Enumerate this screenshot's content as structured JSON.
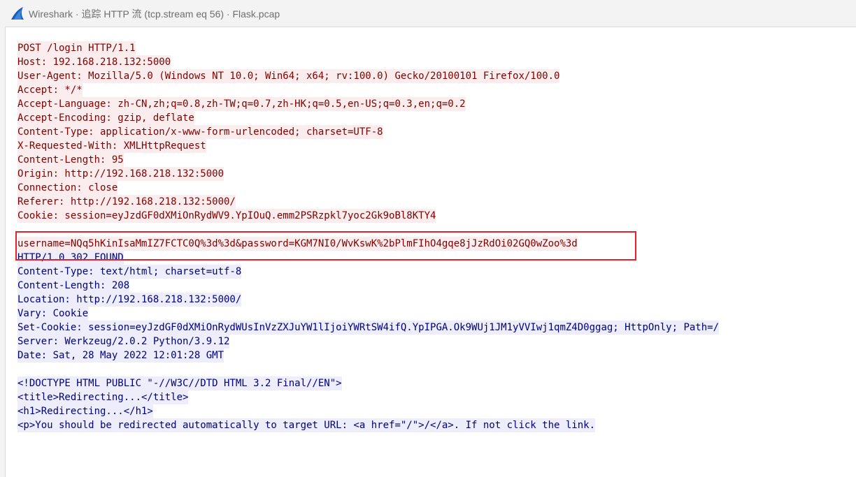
{
  "window": {
    "title": "Wireshark · 追踪 HTTP 流 (tcp.stream eq 56) · Flask.pcap",
    "icon": "wireshark-fin-icon"
  },
  "colors": {
    "client_text": "#7f0000",
    "client_bg": "#fbeded",
    "server_text": "#00007f",
    "server_bg": "#ededfb",
    "highlight_border": "#e3222b"
  },
  "request": {
    "lines": [
      "POST /login HTTP/1.1",
      "Host: 192.168.218.132:5000",
      "User-Agent: Mozilla/5.0 (Windows NT 10.0; Win64; x64; rv:100.0) Gecko/20100101 Firefox/100.0",
      "Accept: */*",
      "Accept-Language: zh-CN,zh;q=0.8,zh-TW;q=0.7,zh-HK;q=0.5,en-US;q=0.3,en;q=0.2",
      "Accept-Encoding: gzip, deflate",
      "Content-Type: application/x-www-form-urlencoded; charset=UTF-8",
      "X-Requested-With: XMLHttpRequest",
      "Content-Length: 95",
      "Origin: http://192.168.218.132:5000",
      "Connection: close",
      "Referer: http://192.168.218.132:5000/",
      "Cookie: session=eyJzdGF0dXMiOnRydWV9.YpIOuQ.emm2PSRzpkl7yoc2Gk9oBl8KTY4"
    ],
    "body": "username=NQq5hKinIsaMmIZ7FCTC0Q%3d%3d&password=KGM7NI0/WvKswK%2bPlmFIhO4gqe8jJzRdOi02GQ0wZoo%3d"
  },
  "response": {
    "status_line": "HTTP/1.0 302 FOUND",
    "headers": [
      "Content-Type: text/html; charset=utf-8",
      "Content-Length: 208",
      "Location: http://192.168.218.132:5000/",
      "Vary: Cookie",
      "Set-Cookie: session=eyJzdGF0dXMiOnRydWUsInVzZXJuYW1lIjoiYWRtSW4ifQ.YpIPGA.Ok9WUj1JM1yVVIwj1qmZ4D0ggag; HttpOnly; Path=/",
      "Server: Werkzeug/2.0.2 Python/3.9.12",
      "Date: Sat, 28 May 2022 12:01:28 GMT"
    ],
    "body": [
      "<!DOCTYPE HTML PUBLIC \"-//W3C//DTD HTML 3.2 Final//EN\">",
      "<title>Redirecting...</title>",
      "<h1>Redirecting...</h1>",
      "<p>You should be redirected automatically to target URL: <a href=\"/\">/</a>. If not click the link."
    ]
  }
}
